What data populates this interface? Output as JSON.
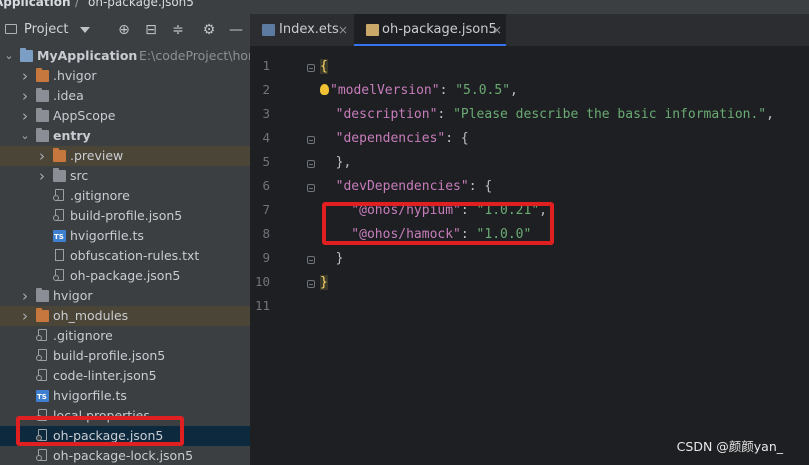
{
  "breadcrumb": {
    "project": "Application",
    "separator": "/",
    "file": "oh-package.json5"
  },
  "project_panel": {
    "title": "Project",
    "toolbar_icons": [
      "crosshair-icon",
      "collapse-all-icon",
      "expand-all-icon",
      "gear-icon",
      "minimize-icon"
    ],
    "tree": [
      {
        "label": "MyApplication",
        "sub": "E:\\codeProject\\horm",
        "indent": 0,
        "arrow": "down",
        "icon": "folder-blue",
        "bold": true
      },
      {
        "label": ".hvigor",
        "indent": 1,
        "arrow": "right",
        "icon": "folder-orange"
      },
      {
        "label": ".idea",
        "indent": 1,
        "arrow": "right",
        "icon": "folder"
      },
      {
        "label": "AppScope",
        "indent": 1,
        "arrow": "right",
        "icon": "folder"
      },
      {
        "label": "entry",
        "indent": 1,
        "arrow": "down",
        "icon": "folder",
        "bold": true
      },
      {
        "label": ".preview",
        "indent": 2,
        "arrow": "right",
        "icon": "folder-orange",
        "highlight": "dark"
      },
      {
        "label": "src",
        "indent": 2,
        "arrow": "right",
        "icon": "folder"
      },
      {
        "label": ".gitignore",
        "indent": 2,
        "arrow": "",
        "icon": "file"
      },
      {
        "label": "build-profile.json5",
        "indent": 2,
        "arrow": "",
        "icon": "file"
      },
      {
        "label": "hvigorfile.ts",
        "indent": 2,
        "arrow": "",
        "icon": "ts"
      },
      {
        "label": "obfuscation-rules.txt",
        "indent": 2,
        "arrow": "",
        "icon": "txt"
      },
      {
        "label": "oh-package.json5",
        "indent": 2,
        "arrow": "",
        "icon": "file"
      },
      {
        "label": "hvigor",
        "indent": 1,
        "arrow": "right",
        "icon": "folder"
      },
      {
        "label": "oh_modules",
        "indent": 1,
        "arrow": "right",
        "icon": "folder-orange",
        "highlight": "dark"
      },
      {
        "label": ".gitignore",
        "indent": 1,
        "arrow": "",
        "icon": "file"
      },
      {
        "label": "build-profile.json5",
        "indent": 1,
        "arrow": "",
        "icon": "file"
      },
      {
        "label": "code-linter.json5",
        "indent": 1,
        "arrow": "",
        "icon": "file"
      },
      {
        "label": "hvigorfile.ts",
        "indent": 1,
        "arrow": "",
        "icon": "ts"
      },
      {
        "label": "local.properties",
        "indent": 1,
        "arrow": "",
        "icon": "file"
      },
      {
        "label": "oh-package.json5",
        "indent": 1,
        "arrow": "",
        "icon": "file",
        "highlight": "blue"
      },
      {
        "label": "oh-package-lock.json5",
        "indent": 1,
        "arrow": "",
        "icon": "file"
      }
    ]
  },
  "editor": {
    "tabs": [
      {
        "label": "Index.ets",
        "close": "×",
        "active": false,
        "icon": "ets-file-icon"
      },
      {
        "label": "oh-package.json5",
        "close": "×",
        "active": true,
        "icon": "json-file-icon"
      }
    ],
    "line_numbers": [
      "1",
      "2",
      "3",
      "4",
      "5",
      "6",
      "7",
      "8",
      "9",
      "10",
      "11"
    ],
    "lines": [
      [
        {
          "t": "{",
          "c": "br"
        }
      ],
      [
        {
          "t": "\"modelVersion\"",
          "c": "k",
          "bulb": true
        },
        {
          "t": ": ",
          "c": "p"
        },
        {
          "t": "\"5.0.5\"",
          "c": "s"
        },
        {
          "t": ",",
          "c": "p"
        }
      ],
      [
        {
          "t": "  \"description\"",
          "c": "k"
        },
        {
          "t": ": ",
          "c": "p"
        },
        {
          "t": "\"Please describe the basic information.\"",
          "c": "s"
        },
        {
          "t": ",",
          "c": "p"
        }
      ],
      [
        {
          "t": "  \"dependencies\"",
          "c": "k"
        },
        {
          "t": ": {",
          "c": "p"
        }
      ],
      [
        {
          "t": "  },",
          "c": "p"
        }
      ],
      [
        {
          "t": "  \"devDependencies\"",
          "c": "k"
        },
        {
          "t": ": {",
          "c": "p"
        }
      ],
      [
        {
          "t": "    \"@ohos/hypium\"",
          "c": "k"
        },
        {
          "t": ": ",
          "c": "p"
        },
        {
          "t": "\"1.0.21\"",
          "c": "s"
        },
        {
          "t": ",",
          "c": "p"
        }
      ],
      [
        {
          "t": "    \"@ohos/hamock\"",
          "c": "k"
        },
        {
          "t": ": ",
          "c": "p"
        },
        {
          "t": "\"1.0.0\"",
          "c": "s"
        }
      ],
      [
        {
          "t": "  }",
          "c": "p"
        }
      ],
      [
        {
          "t": "}",
          "c": "br"
        }
      ],
      []
    ]
  },
  "watermark": "CSDN @颜颜yan_",
  "colors": {
    "highlight_box": "#e02020",
    "accent": "#3574f0"
  }
}
